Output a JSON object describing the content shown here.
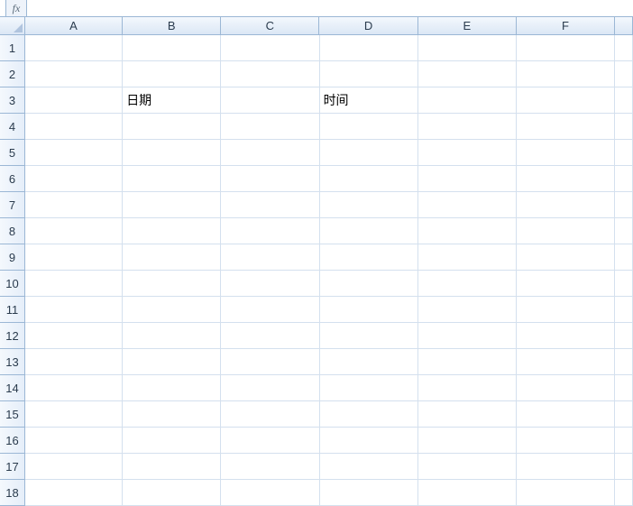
{
  "formula_bar": {
    "fx_label": "fx",
    "value": ""
  },
  "columns": [
    "A",
    "B",
    "C",
    "D",
    "E",
    "F"
  ],
  "extra_col": "",
  "rows": [
    "1",
    "2",
    "3",
    "4",
    "5",
    "6",
    "7",
    "8",
    "9",
    "10",
    "11",
    "12",
    "13",
    "14",
    "15",
    "16",
    "17",
    "18"
  ],
  "cells": {
    "B3": "日期",
    "D3": "时间"
  }
}
